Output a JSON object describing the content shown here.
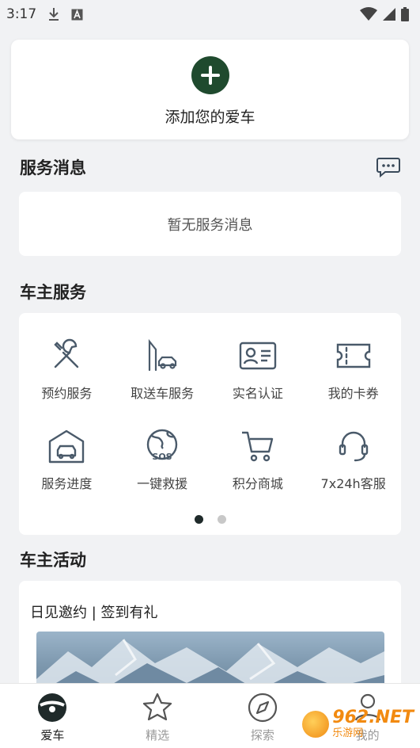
{
  "status_bar": {
    "time": "3:17"
  },
  "add_car": {
    "label": "添加您的爱车"
  },
  "service_messages": {
    "title": "服务消息",
    "empty_text": "暂无服务消息"
  },
  "owner_services": {
    "title": "车主服务",
    "items": [
      {
        "label": "预约服务",
        "icon": "wrench-screwdriver-icon"
      },
      {
        "label": "取送车服务",
        "icon": "car-pickup-icon"
      },
      {
        "label": "实名认证",
        "icon": "id-card-icon"
      },
      {
        "label": "我的卡券",
        "icon": "coupon-ticket-icon"
      },
      {
        "label": "服务进度",
        "icon": "garage-icon"
      },
      {
        "label": "一键救援",
        "icon": "sos-globe-icon"
      },
      {
        "label": "积分商城",
        "icon": "shopping-cart-icon"
      },
      {
        "label": "7x24h客服",
        "icon": "headset-icon"
      }
    ],
    "page_count": 2,
    "active_page": 1
  },
  "owner_activities": {
    "title": "车主活动",
    "card_title": "日见邀约 | 签到有礼"
  },
  "tab_bar": {
    "tabs": [
      {
        "label": "爱车",
        "icon": "steering-wheel-icon",
        "active": true
      },
      {
        "label": "精选",
        "icon": "star-icon",
        "active": false
      },
      {
        "label": "探索",
        "icon": "compass-icon",
        "active": false
      },
      {
        "label": "我的",
        "icon": "person-icon",
        "active": false
      }
    ]
  },
  "watermark": {
    "main": "962.NET",
    "sub": "乐游网"
  },
  "colors": {
    "accent": "#1f4a2e",
    "background": "#f1f2f4",
    "icon": "#4a5a6a"
  }
}
